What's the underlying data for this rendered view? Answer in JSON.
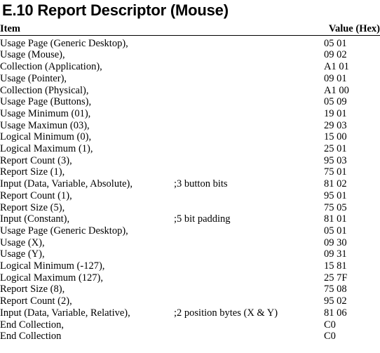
{
  "document": {
    "title": "E.10 Report Descriptor (Mouse)"
  },
  "table": {
    "headers": {
      "item": "Item",
      "comment": "",
      "value": "Value (Hex)"
    },
    "rows": [
      {
        "indent": 0,
        "item": "Usage Page (Generic Desktop),",
        "comment": "",
        "value": "05 01"
      },
      {
        "indent": 0,
        "item": "Usage (Mouse),",
        "comment": "",
        "value": "09 02"
      },
      {
        "indent": 1,
        "item": "Collection (Application),",
        "comment": "",
        "value": "A1 01"
      },
      {
        "indent": 2,
        "item": "Usage (Pointer),",
        "comment": "",
        "value": "09 01"
      },
      {
        "indent": 2,
        "item": "Collection (Physical),",
        "comment": "",
        "value": "A1 00"
      },
      {
        "indent": 3,
        "item": "Usage Page (Buttons),",
        "comment": "",
        "value": "05 09"
      },
      {
        "indent": 3,
        "item": "Usage Minimum (01),",
        "comment": "",
        "value": "19 01"
      },
      {
        "indent": 3,
        "item": "Usage Maximun (03),",
        "comment": "",
        "value": "29 03"
      },
      {
        "indent": 3,
        "item": "Logical Minimum (0),",
        "comment": "",
        "value": "15 00"
      },
      {
        "indent": 3,
        "item": "Logical Maximum (1),",
        "comment": "",
        "value": "25 01"
      },
      {
        "indent": 3,
        "item": "Report Count (3),",
        "comment": "",
        "value": "95 03"
      },
      {
        "indent": 3,
        "item": "Report Size (1),",
        "comment": "",
        "value": "75 01"
      },
      {
        "indent": 3,
        "item": "Input (Data, Variable, Absolute),",
        "comment": ";3 button bits",
        "value": "81 02"
      },
      {
        "indent": 3,
        "item": "Report Count (1),",
        "comment": "",
        "value": "95 01"
      },
      {
        "indent": 3,
        "item": "Report Size (5),",
        "comment": "",
        "value": "75 05"
      },
      {
        "indent": 3,
        "item": "Input (Constant),",
        "comment": ";5 bit padding",
        "value": "81 01"
      },
      {
        "indent": 3,
        "item": "Usage Page (Generic Desktop),",
        "comment": "",
        "value": "05 01"
      },
      {
        "indent": 3,
        "item": "Usage (X),",
        "comment": "",
        "value": "09 30"
      },
      {
        "indent": 3,
        "item": "Usage (Y),",
        "comment": "",
        "value": "09 31"
      },
      {
        "indent": 3,
        "item": "Logical Minimum (-127),",
        "comment": "",
        "value": "15 81"
      },
      {
        "indent": 3,
        "item": "Logical Maximum (127),",
        "comment": "",
        "value": "25 7F"
      },
      {
        "indent": 3,
        "item": "Report Size (8),",
        "comment": "",
        "value": "75 08"
      },
      {
        "indent": 3,
        "item": "Report Count (2),",
        "comment": "",
        "value": "95 02"
      },
      {
        "indent": 3,
        "item": "Input (Data, Variable, Relative),",
        "comment": ";2 position bytes (X & Y)",
        "value": "81 06"
      },
      {
        "indent": 2,
        "item": "End Collection,",
        "comment": "",
        "value": "C0"
      },
      {
        "indent": 0,
        "item": "End Collection",
        "comment": "",
        "value": "C0"
      }
    ]
  }
}
